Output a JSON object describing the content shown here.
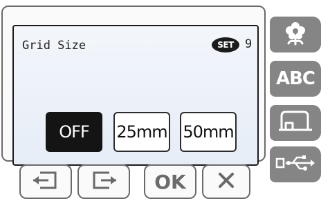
{
  "screen": {
    "title": "Grid Size",
    "set_badge": "SET",
    "set_number": "9"
  },
  "grid_options": [
    {
      "label": "OFF",
      "selected": true
    },
    {
      "label": "25mm",
      "selected": false
    },
    {
      "label": "50mm",
      "selected": false
    }
  ],
  "side_buttons": [
    {
      "icon": "flower-icon"
    },
    {
      "label": "ABC",
      "icon": "abc-text-icon"
    },
    {
      "icon": "sewing-machine-icon"
    },
    {
      "icon": "usb-icon"
    }
  ],
  "bottom_buttons": [
    {
      "icon": "previous-page-icon"
    },
    {
      "icon": "next-page-icon"
    },
    {
      "label": "OK",
      "icon": "ok-icon"
    },
    {
      "icon": "close-icon"
    }
  ],
  "colors": {
    "selected_option": "#141414",
    "side_button": "#858585",
    "outline": "#6a6a6a"
  }
}
